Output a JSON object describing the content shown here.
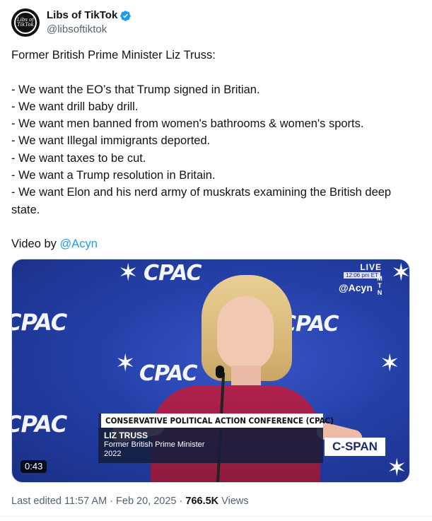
{
  "author": {
    "display_name": "Libs of TikTok",
    "handle": "@libsoftiktok",
    "avatar_text": "Libs of TikTok",
    "verified": true
  },
  "tweet": {
    "lines": [
      "Former British Prime Minister Liz Truss:",
      "",
      "- We want the EO’s that Trump signed in Britian.",
      "- We want drill baby drill.",
      "- We want men banned from women's bathrooms & women's sports.",
      "- We want Illegal immigrants deported.",
      "- We want taxes to be cut.",
      "- We want a Trump resolution in Britain.",
      "- We want Elon and his nerd army of muskrats examining the British deep state.",
      ""
    ],
    "credit_prefix": "Video by ",
    "credit_mention": "@Acyn"
  },
  "video": {
    "cpac_text": "CPAC",
    "live_label": "LIVE",
    "live_time": "12:06 pm ET",
    "watermark": "@Acyn",
    "mtn_letters": [
      "M",
      "T",
      "N"
    ],
    "lower_third": {
      "title": "CONSERVATIVE POLITICAL ACTION CONFERENCE (CPAC)",
      "name": "LIZ TRUSS",
      "role": "Former British Prime Minister",
      "year": "2022"
    },
    "network_logo": "C-SPAN",
    "duration": "0:43"
  },
  "meta": {
    "edited": "Last edited 11:57 AM · Feb 20, 2025 · ",
    "views_count": "766.5K",
    "views_label": " Views"
  },
  "colors": {
    "link": "#1d9bf0",
    "verified": "#1d9bf0",
    "secondary_text": "#536471"
  }
}
